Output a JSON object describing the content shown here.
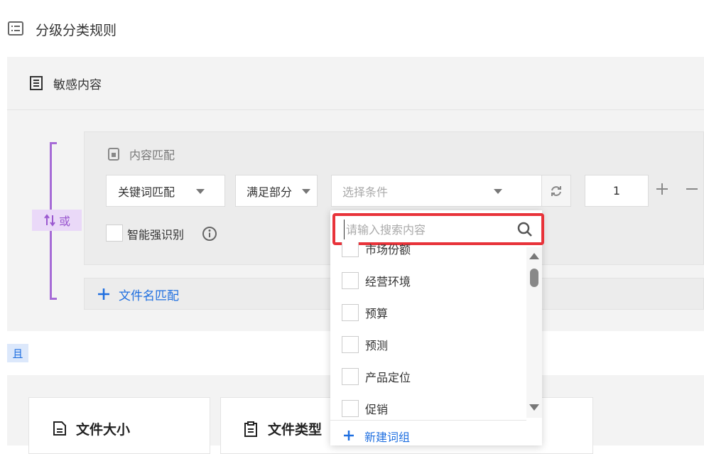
{
  "page": {
    "title": "分级分类规则"
  },
  "sensitive": {
    "title": "敏感内容",
    "or_label": "或",
    "content_match": {
      "title": "内容匹配",
      "match_type": "关键词匹配",
      "satisfy": "满足部分",
      "condition_placeholder": "选择条件",
      "count": "1",
      "smart_label": "智能强识别"
    },
    "filename_label": "文件名匹配"
  },
  "and_label": "且",
  "cards": {
    "file_size": "文件大小",
    "file_type": "文件类型"
  },
  "dropdown": {
    "search_placeholder": "请输入搜索内容",
    "items": [
      "市场份额",
      "经营环境",
      "预算",
      "预测",
      "产品定位",
      "促销"
    ],
    "new_group": "新建词组"
  },
  "colors": {
    "accent": "#1f6fe0",
    "or_purple": "#a66bd6",
    "highlight_red": "#e8333a"
  },
  "icons": [
    "doc-list-icon",
    "document-icon",
    "content-lock-icon",
    "caret-down-icon",
    "refresh-icon",
    "plus-icon",
    "minus-icon",
    "info-icon",
    "search-icon",
    "swap-icon",
    "clipboard-icon"
  ]
}
